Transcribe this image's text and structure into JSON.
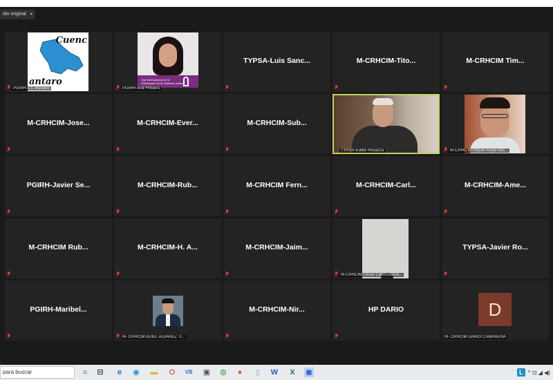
{
  "view_button": {
    "label": "ido original",
    "caret": "▾"
  },
  "tiles": [
    {
      "id": "t1",
      "display": "",
      "label": "PGIRH-CC Mariano",
      "image": "map"
    },
    {
      "id": "t2",
      "display": "",
      "label": "PGIRH-Ana Flowers",
      "image": "ana"
    },
    {
      "id": "t3",
      "display": "TYPSA-Luis  Sanc...",
      "label": "",
      "image": ""
    },
    {
      "id": "t4",
      "display": "M-CRHCIM-Tito...",
      "label": "",
      "image": ""
    },
    {
      "id": "t5",
      "display": "M-CRHCIM  Tim...",
      "label": "",
      "image": ""
    },
    {
      "id": "t6",
      "display": "M-CRHCIM-Jose...",
      "label": "",
      "image": ""
    },
    {
      "id": "t7",
      "display": "M-CRHCIM-Ever...",
      "label": "",
      "image": ""
    },
    {
      "id": "t8",
      "display": "M-CRHCIM-Sub...",
      "label": "",
      "image": ""
    },
    {
      "id": "t9",
      "display": "",
      "label": "TYPSA-Eddie Rosazza",
      "image": "eddie"
    },
    {
      "id": "t10",
      "display": "",
      "label": "M-CRHC M-Miguel Angel Bas...",
      "image": "miguel"
    },
    {
      "id": "t11",
      "display": "PGIRH-Javier  Se...",
      "label": "",
      "image": ""
    },
    {
      "id": "t12",
      "display": "M-CRHCIM-Rub...",
      "label": "",
      "image": ""
    },
    {
      "id": "t13",
      "display": "M-CRHCIM  Fern...",
      "label": "",
      "image": ""
    },
    {
      "id": "t14",
      "display": "M-CRHCIM-Carl...",
      "label": "",
      "image": ""
    },
    {
      "id": "t15",
      "display": "M-CRHCIM-Ame...",
      "label": "",
      "image": ""
    },
    {
      "id": "t16",
      "display": "M-CRHCIM  Rub...",
      "label": "",
      "image": ""
    },
    {
      "id": "t17",
      "display": "M-CRHCIM-H.  A...",
      "label": "",
      "image": ""
    },
    {
      "id": "t18",
      "display": "M-CRHCIM-Jaim...",
      "label": "",
      "image": ""
    },
    {
      "id": "t19",
      "display": "",
      "label": "M-CRHCIM César Canchucnca...",
      "image": "cesar"
    },
    {
      "id": "t20",
      "display": "TYPSA-Javier  Ro...",
      "label": "",
      "image": ""
    },
    {
      "id": "t21",
      "display": "PGIRH-Maribel...",
      "label": "",
      "image": ""
    },
    {
      "id": "t22",
      "display": "",
      "label": "M- CRHCIM ADIEL ALVAREZ TI...",
      "image": "adiel"
    },
    {
      "id": "t23",
      "display": "M-CRHCIM-Nir...",
      "label": "",
      "image": ""
    },
    {
      "id": "t24",
      "display": "HP DARIO",
      "label": "",
      "image": ""
    },
    {
      "id": "t25",
      "display": "",
      "label": "M- CRHCIM DARIO CAMARENA",
      "image": "avatar",
      "avatar_letter": "D"
    }
  ],
  "map_text": {
    "top": "Cuenc",
    "bottom": "antaro"
  },
  "ana_band_text": "Día Internacional de la Eliminación de la Violencia contra la Mujer",
  "taskbar": {
    "search_text": "para buscar",
    "tray_letter": "L",
    "tray_icons": "^ ⊡ ◢ ◀)"
  }
}
